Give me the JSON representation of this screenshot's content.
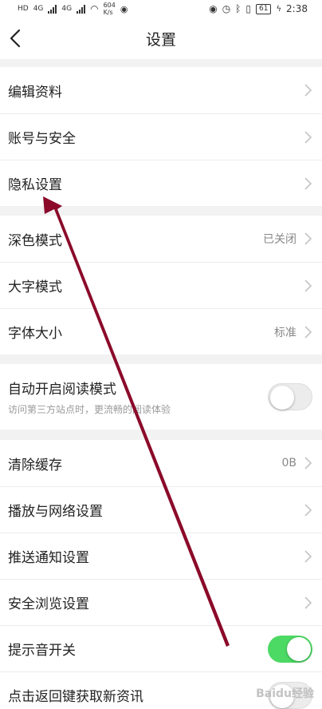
{
  "status_bar": {
    "net_speed": "604",
    "net_speed_unit": "K/s",
    "time": "2:38",
    "battery": "61",
    "net_4g_1": "4G",
    "net_4g_2": "4G",
    "hd_label": "HD"
  },
  "nav": {
    "title": "设置",
    "back_icon": "chevron-left-icon"
  },
  "group1": {
    "items": [
      {
        "label": "编辑资料"
      },
      {
        "label": "账号与安全"
      },
      {
        "label": "隐私设置"
      }
    ]
  },
  "group2": {
    "items": [
      {
        "label": "深色模式",
        "value": "已关闭"
      },
      {
        "label": "大字模式",
        "value": ""
      },
      {
        "label": "字体大小",
        "value": "标准"
      }
    ]
  },
  "group3": {
    "reading_mode": {
      "label": "自动开启阅读模式",
      "sub": "访问第三方站点时，更流畅的阅读体验",
      "enabled": false
    }
  },
  "group4": {
    "items": [
      {
        "label": "清除缓存",
        "value": "0B"
      },
      {
        "label": "播放与网络设置",
        "value": ""
      },
      {
        "label": "推送通知设置",
        "value": ""
      },
      {
        "label": "安全浏览设置",
        "value": ""
      }
    ],
    "sound_switch": {
      "label": "提示音开关",
      "enabled": true
    },
    "back_refresh": {
      "label": "点击返回键获取新资讯"
    }
  },
  "watermark": "Baidu经验",
  "colors": {
    "toggle_on": "#4cd964",
    "arrow": "#8b0a2a"
  }
}
